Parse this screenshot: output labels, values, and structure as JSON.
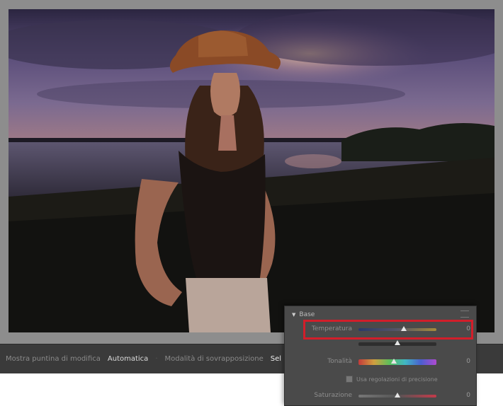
{
  "toolbar": {
    "mode_label": "Mostra puntina di modifica",
    "mode_value": "Automatica",
    "overlay_label": "Modalità di sovrapposizione",
    "overlay_value": "Sel"
  },
  "panel": {
    "section_title": "Base",
    "rows": [
      {
        "label": "Temperatura",
        "value": "0",
        "knob": 0.58
      },
      {
        "label": "",
        "value": "",
        "knob": 0.5
      },
      {
        "label": "Tonalità",
        "value": "0",
        "knob": 0.45
      },
      {
        "label": "Saturazione",
        "value": "0",
        "knob": 0.5
      }
    ],
    "checkbox_label": "Usa regolazioni di precisione"
  },
  "colors": {
    "highlight": "#d21e2a",
    "panel_bg": "#4a4a4a",
    "toolbar_bg": "#3a3a3a"
  }
}
